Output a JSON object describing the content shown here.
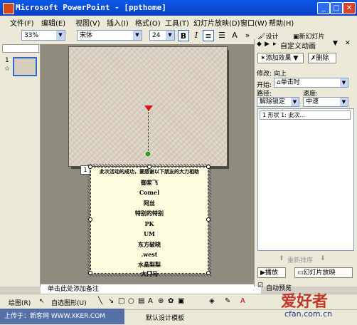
{
  "window": {
    "title": "Microsoft PowerPoint - [ppthome]",
    "minimize": "_",
    "maximize": "□",
    "close": "✕"
  },
  "menu": [
    "文件(F)",
    "编辑(E)",
    "视图(V)",
    "插入(I)",
    "格式(O)",
    "工具(T)",
    "幻灯片放映(D)",
    "窗口(W)",
    "帮助(H)"
  ],
  "toolbar": {
    "zoom": "33%",
    "font": "宋体",
    "font_size": "24",
    "bold": "B",
    "italic": "I",
    "design": "设计",
    "new_slide": "新幻灯片"
  },
  "slide_panel": {
    "slide_number": "1"
  },
  "slide": {
    "anim_tag": "1",
    "textbox_lines": [
      "此次活动的成功，要感谢以下朋友的大力相助",
      "御浆飞",
      "Comel",
      "阿丝",
      "特别的特别",
      "PK",
      "UM",
      "东方破晓",
      ".west",
      "水晶梨梨",
      "大河马"
    ]
  },
  "notes": {
    "placeholder": "单击此处添加备注"
  },
  "task_pane": {
    "title": "自定义动画",
    "add_effect": "添加效果",
    "remove": "删除",
    "modify_label": "修改: 向上",
    "start_label": "开始:",
    "start_value": "单击时",
    "path_label": "路径:",
    "speed_label": "速度:",
    "path_value": "解除锁定",
    "speed_value": "中速",
    "list_item": "1  形状 1: 此次...",
    "reorder": "重新排序",
    "play": "播放",
    "slideshow": "幻灯片放映",
    "autopreview": "自动预览"
  },
  "drawing_toolbar": {
    "draw": "绘图(R)",
    "autoshapes": "自选图形(U)"
  },
  "status": {
    "template": "默认设计模板"
  },
  "watermark": {
    "left": "上传于：新客网 WWW.XKER.COM",
    "right_logo": "爱好者",
    "right_url": "cfan.com.cn"
  }
}
